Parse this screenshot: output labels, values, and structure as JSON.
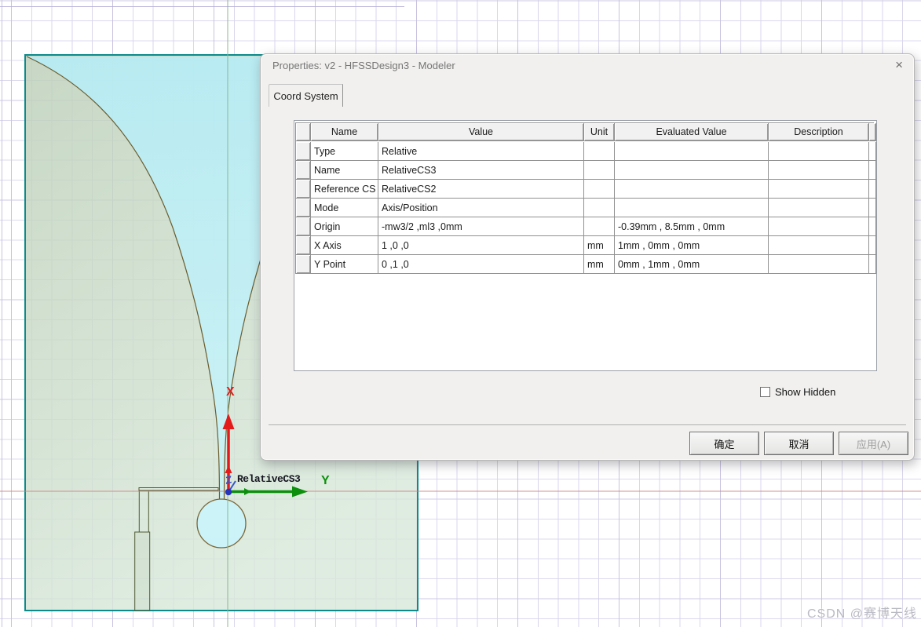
{
  "dialog": {
    "title": "Properties: v2 - HFSSDesign3 - Modeler",
    "close_glyph": "×",
    "tab_label": "Coord System",
    "table": {
      "headers": [
        "Name",
        "Value",
        "Unit",
        "Evaluated Value",
        "Description"
      ],
      "rows": [
        {
          "name": "Type",
          "value": "Relative",
          "unit": "",
          "evaluated": "",
          "description": ""
        },
        {
          "name": "Name",
          "value": "RelativeCS3",
          "unit": "",
          "evaluated": "",
          "description": ""
        },
        {
          "name": "Reference CS",
          "value": "RelativeCS2",
          "unit": "",
          "evaluated": "",
          "description": ""
        },
        {
          "name": "Mode",
          "value": "Axis/Position",
          "unit": "",
          "evaluated": "",
          "description": ""
        },
        {
          "name": "Origin",
          "value": "-mw3/2 ,ml3 ,0mm",
          "unit": "",
          "evaluated": "-0.39mm , 8.5mm , 0mm",
          "description": ""
        },
        {
          "name": "X Axis",
          "value": "1 ,0 ,0",
          "unit": "mm",
          "evaluated": "1mm , 0mm , 0mm",
          "description": ""
        },
        {
          "name": "Y Point",
          "value": "0 ,1 ,0",
          "unit": "mm",
          "evaluated": "0mm , 1mm , 0mm",
          "description": ""
        }
      ]
    },
    "show_hidden_label": "Show Hidden",
    "buttons": {
      "ok": "确定",
      "cancel": "取消",
      "apply": "应用(A)"
    }
  },
  "viewport": {
    "cs_label": "RelativeCS3",
    "axis_x_label": "X",
    "axis_y_label": "Y",
    "axis_z_label": "Z",
    "colors": {
      "x_axis": "#e31b1b",
      "y_axis": "#0c8f0c",
      "z_axis": "#3a54c8",
      "sheet_border": "#0d8b8b",
      "taper_outline": "#6b5d2e",
      "slot_fill_cyan": "#bceef6",
      "metal_fill_green": "#c6d7c3",
      "grid_minor": "#dcd8ee",
      "axis_line_green": "#8cba8c",
      "edge_line_red": "#cc8080"
    }
  },
  "watermark": "CSDN @赛博天线"
}
